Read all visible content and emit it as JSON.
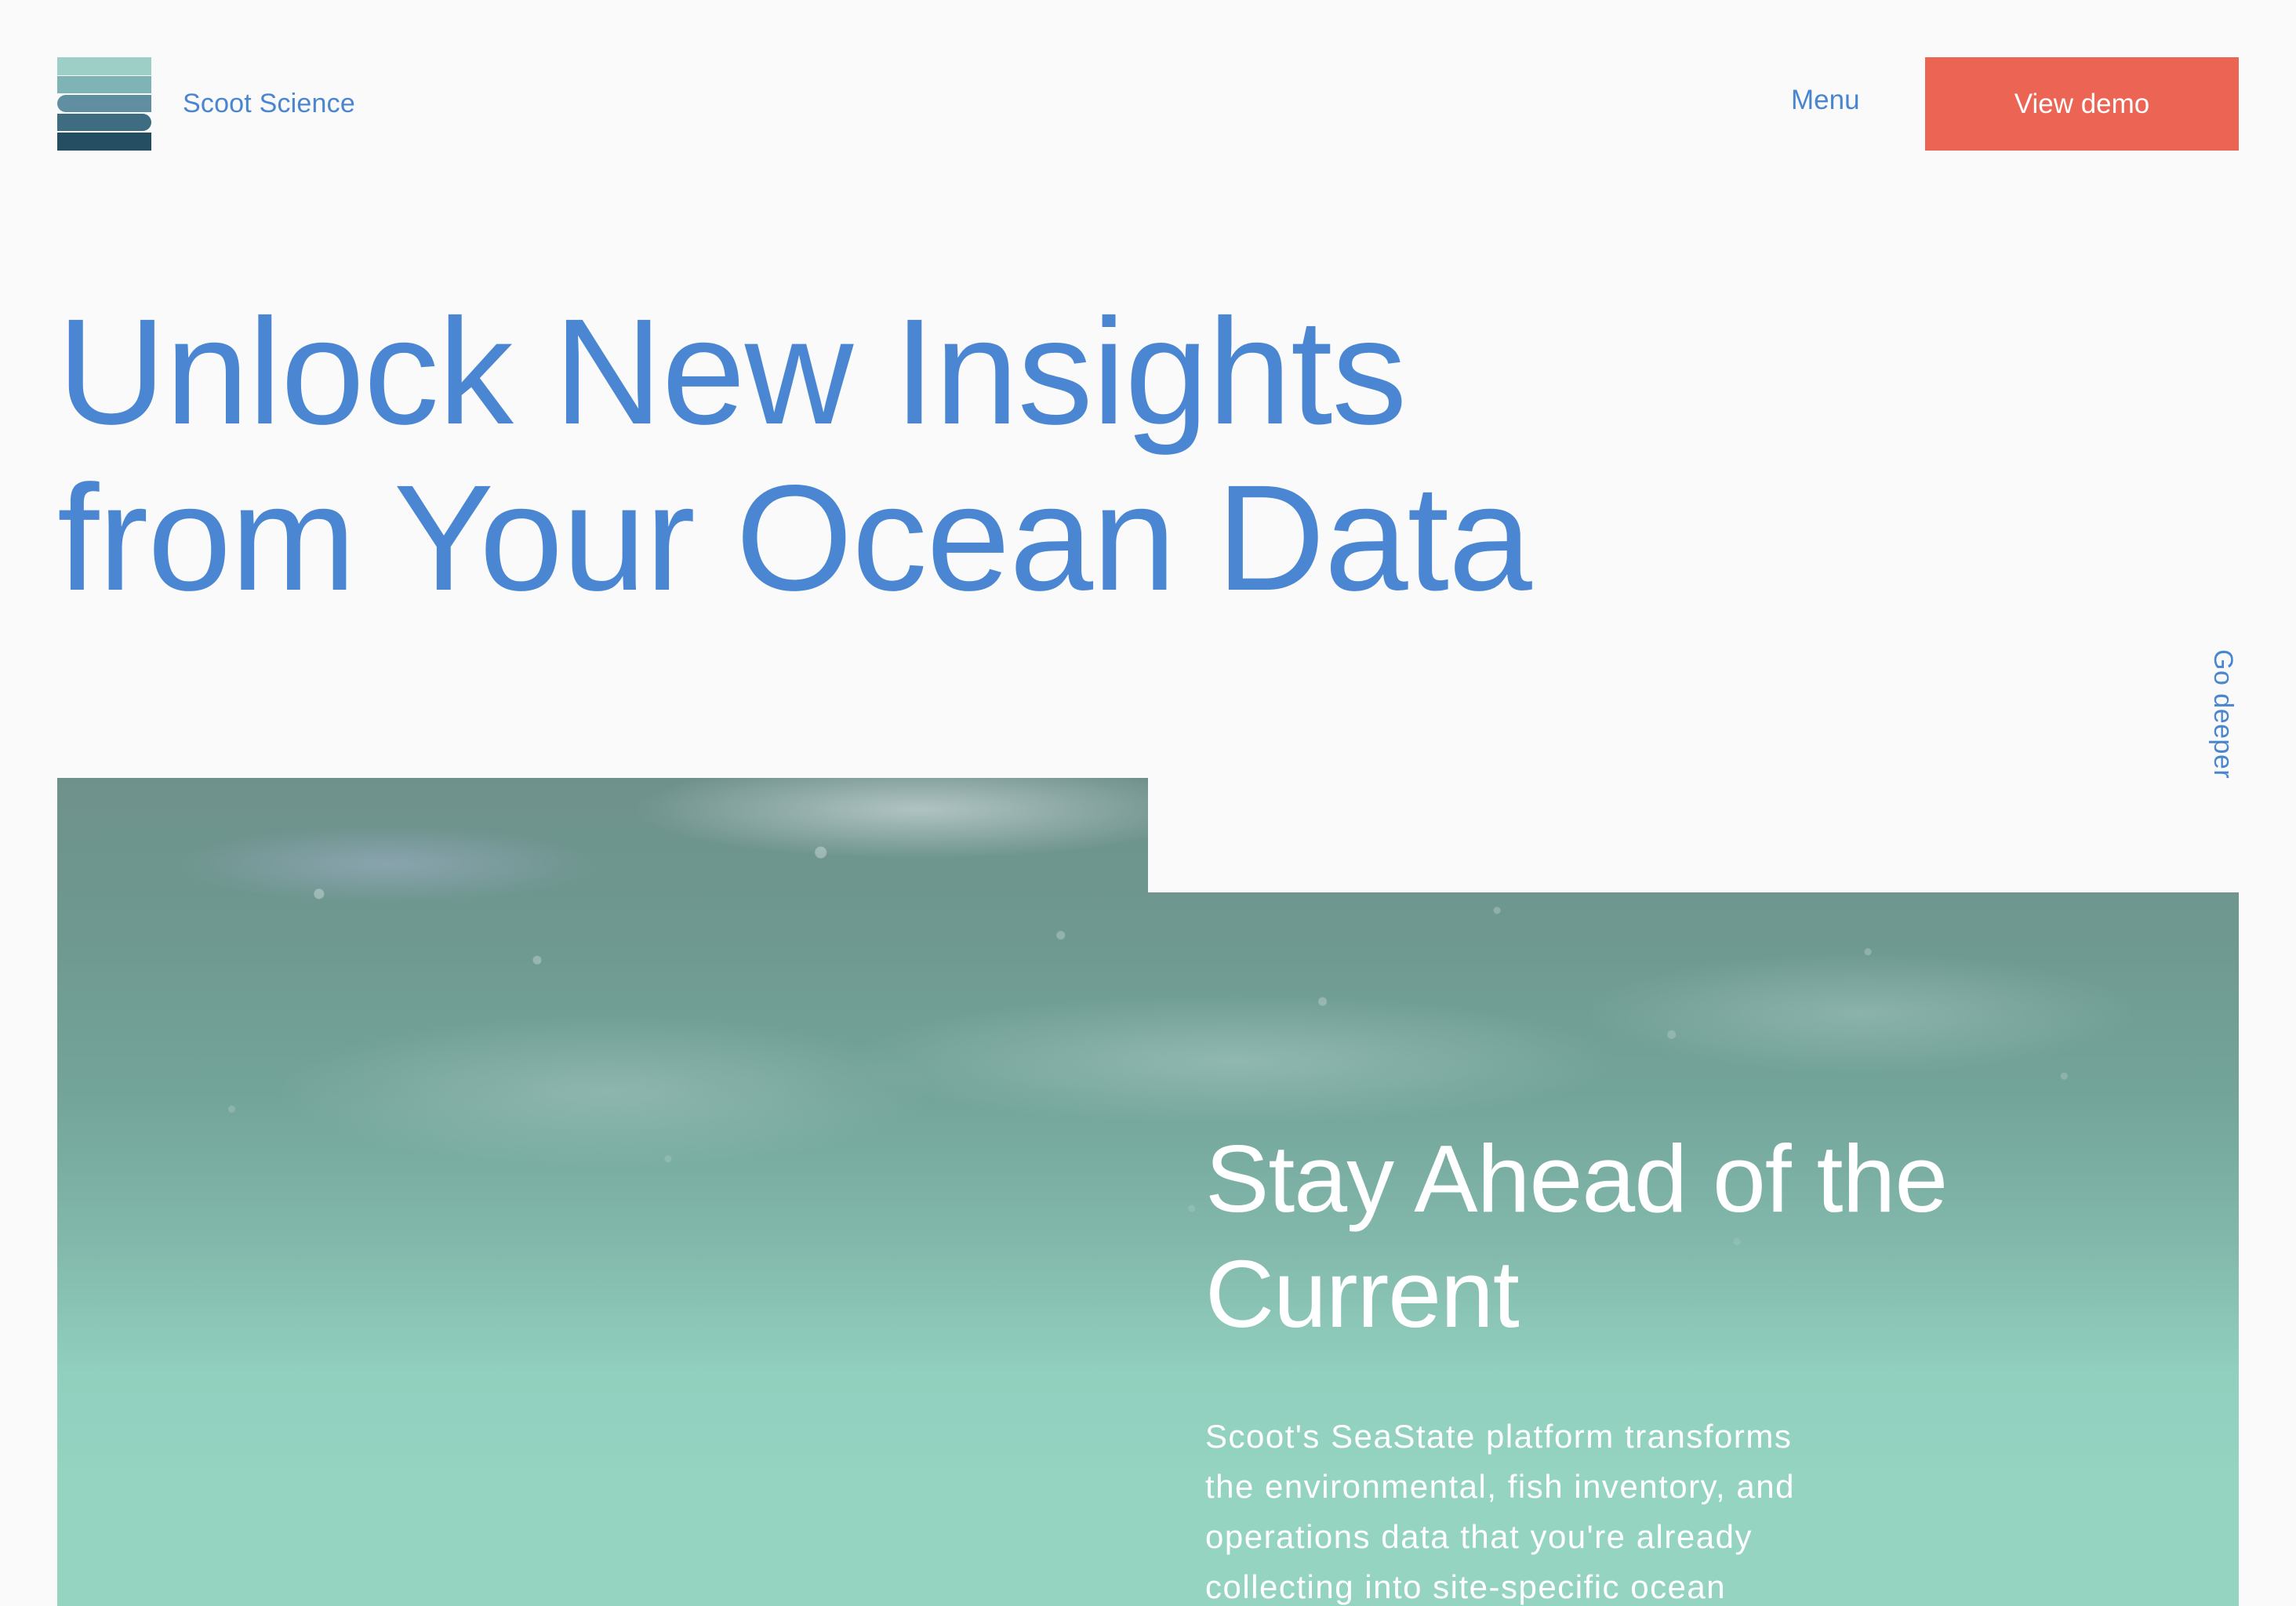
{
  "header": {
    "brand_name": "Scoot Science",
    "menu_label": "Menu",
    "cta_label": "View demo"
  },
  "hero": {
    "title_line1": "Unlock New Insights",
    "title_line2": "from Your Ocean Data",
    "scroll_cue": "Go deeper"
  },
  "feature": {
    "title_line1": "Stay Ahead of the",
    "title_line2": "Current",
    "body": "Scoot's SeaState platform transforms the environmental, fish inventory, and operations data that you're already collecting into site-specific ocean"
  },
  "colors": {
    "accent_blue": "#4a86cf",
    "cta_coral": "#ec6554",
    "background": "#fafafa",
    "water_teal": "#95d4c1"
  },
  "icons": {
    "logo": "stacked-layers-logo"
  }
}
